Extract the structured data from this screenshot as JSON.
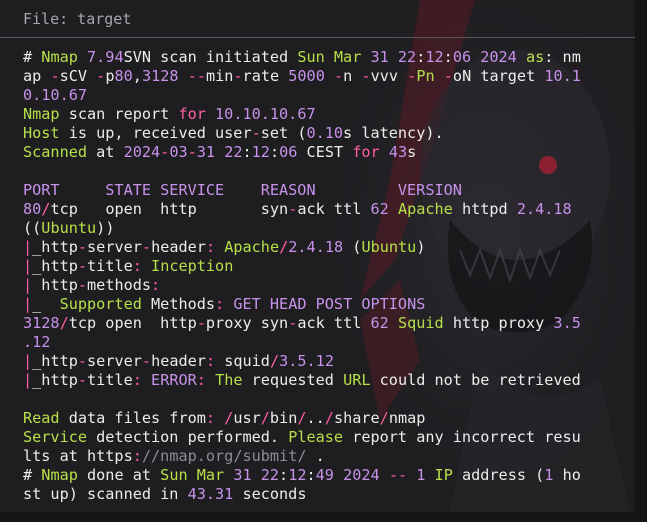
{
  "header": {
    "title": "File: target"
  },
  "colors": {
    "background": "#1e1d20",
    "green": "#b6e04a",
    "purple": "#c792ea",
    "pink": "#ff5fa0",
    "text": "#e8e6ea",
    "header_text": "#a7a5aa"
  },
  "lines": [
    [
      [
        "w",
        "# "
      ],
      [
        "g",
        "Nmap "
      ],
      [
        "p",
        "7.94"
      ],
      [
        "w",
        "SVN scan initiated "
      ],
      [
        "g",
        "Sun Mar "
      ],
      [
        "p",
        "31 22"
      ],
      [
        "w",
        ":"
      ],
      [
        "p",
        "12"
      ],
      [
        "w",
        ":"
      ],
      [
        "p",
        "06 2024 "
      ],
      [
        "g",
        "as"
      ],
      [
        "w",
        ": nm"
      ]
    ],
    [
      [
        "w",
        "ap "
      ],
      [
        "k",
        "-"
      ],
      [
        "w",
        "sCV "
      ],
      [
        "k",
        "-"
      ],
      [
        "w",
        "p"
      ],
      [
        "p",
        "80"
      ],
      [
        "w",
        ","
      ],
      [
        "p",
        "3128 "
      ],
      [
        "k",
        "--"
      ],
      [
        "w",
        "min"
      ],
      [
        "k",
        "-"
      ],
      [
        "w",
        "rate "
      ],
      [
        "p",
        "5000 "
      ],
      [
        "k",
        "-"
      ],
      [
        "w",
        "n "
      ],
      [
        "k",
        "-"
      ],
      [
        "w",
        "vvv "
      ],
      [
        "k",
        "-"
      ],
      [
        "g",
        "Pn "
      ],
      [
        "k",
        "-"
      ],
      [
        "w",
        "oN target "
      ],
      [
        "p",
        "10.1"
      ]
    ],
    [
      [
        "p",
        "0.10.67"
      ]
    ],
    [
      [
        "g",
        "Nmap "
      ],
      [
        "w",
        "scan report "
      ],
      [
        "k",
        "for "
      ],
      [
        "p",
        "10.10.10.67"
      ]
    ],
    [
      [
        "g",
        "Host "
      ],
      [
        "w",
        "is up, received user"
      ],
      [
        "k",
        "-"
      ],
      [
        "w",
        "set ("
      ],
      [
        "p",
        "0.10"
      ],
      [
        "w",
        "s latency)."
      ]
    ],
    [
      [
        "g",
        "Scanned "
      ],
      [
        "w",
        "at "
      ],
      [
        "p",
        "2024"
      ],
      [
        "k",
        "-"
      ],
      [
        "p",
        "03"
      ],
      [
        "k",
        "-"
      ],
      [
        "p",
        "31 22"
      ],
      [
        "w",
        ":"
      ],
      [
        "p",
        "12"
      ],
      [
        "w",
        ":"
      ],
      [
        "p",
        "06 "
      ],
      [
        "w",
        "CEST "
      ],
      [
        "k",
        "for "
      ],
      [
        "p",
        "43"
      ],
      [
        "w",
        "s"
      ]
    ],
    [
      [
        "w",
        ""
      ]
    ],
    [
      [
        "p",
        "PORT     STATE SERVICE    REASON         VERSION"
      ]
    ],
    [
      [
        "p",
        "80"
      ],
      [
        "k",
        "/"
      ],
      [
        "w",
        "tcp   open  http       syn"
      ],
      [
        "k",
        "-"
      ],
      [
        "w",
        "ack ttl "
      ],
      [
        "p",
        "62 "
      ],
      [
        "g",
        "Apache "
      ],
      [
        "w",
        "httpd "
      ],
      [
        "p",
        "2.4.18"
      ]
    ],
    [
      [
        "w",
        "(("
      ],
      [
        "g",
        "Ubuntu"
      ],
      [
        "w",
        "))"
      ]
    ],
    [
      [
        "k",
        "|"
      ],
      [
        "w",
        "_http"
      ],
      [
        "k",
        "-"
      ],
      [
        "w",
        "server"
      ],
      [
        "k",
        "-"
      ],
      [
        "w",
        "header"
      ],
      [
        "k",
        ": "
      ],
      [
        "g",
        "Apache"
      ],
      [
        "k",
        "/"
      ],
      [
        "p",
        "2.4.18 "
      ],
      [
        "w",
        "("
      ],
      [
        "g",
        "Ubuntu"
      ],
      [
        "w",
        ")"
      ]
    ],
    [
      [
        "k",
        "|"
      ],
      [
        "w",
        "_http"
      ],
      [
        "k",
        "-"
      ],
      [
        "w",
        "title"
      ],
      [
        "k",
        ": "
      ],
      [
        "g",
        "Inception"
      ]
    ],
    [
      [
        "k",
        "| "
      ],
      [
        "w",
        "http"
      ],
      [
        "k",
        "-"
      ],
      [
        "w",
        "methods"
      ],
      [
        "k",
        ":"
      ]
    ],
    [
      [
        "k",
        "|"
      ],
      [
        "w",
        "_  "
      ],
      [
        "g",
        "Supported "
      ],
      [
        "w",
        "Methods"
      ],
      [
        "k",
        ": "
      ],
      [
        "p",
        "GET HEAD POST OPTIONS"
      ]
    ],
    [
      [
        "p",
        "3128"
      ],
      [
        "k",
        "/"
      ],
      [
        "w",
        "tcp open  http"
      ],
      [
        "k",
        "-"
      ],
      [
        "w",
        "proxy syn"
      ],
      [
        "k",
        "-"
      ],
      [
        "w",
        "ack ttl "
      ],
      [
        "p",
        "62 "
      ],
      [
        "g",
        "Squid "
      ],
      [
        "w",
        "http proxy "
      ],
      [
        "p",
        "3.5"
      ]
    ],
    [
      [
        "p",
        ".12"
      ]
    ],
    [
      [
        "k",
        "|"
      ],
      [
        "w",
        "_http"
      ],
      [
        "k",
        "-"
      ],
      [
        "w",
        "server"
      ],
      [
        "k",
        "-"
      ],
      [
        "w",
        "header"
      ],
      [
        "k",
        ": "
      ],
      [
        "w",
        "squid"
      ],
      [
        "k",
        "/"
      ],
      [
        "p",
        "3.5.12"
      ]
    ],
    [
      [
        "k",
        "|"
      ],
      [
        "w",
        "_http"
      ],
      [
        "k",
        "-"
      ],
      [
        "w",
        "title"
      ],
      [
        "k",
        ": "
      ],
      [
        "p",
        "ERROR"
      ],
      [
        "k",
        ": "
      ],
      [
        "g",
        "The "
      ],
      [
        "w",
        "requested "
      ],
      [
        "g",
        "URL "
      ],
      [
        "w",
        "could not be retrieved"
      ]
    ],
    [
      [
        "w",
        ""
      ]
    ],
    [
      [
        "g",
        "Read "
      ],
      [
        "w",
        "data files from"
      ],
      [
        "k",
        ": /"
      ],
      [
        "w",
        "usr"
      ],
      [
        "k",
        "/"
      ],
      [
        "w",
        "bin"
      ],
      [
        "k",
        "/"
      ],
      [
        "w",
        ".."
      ],
      [
        "k",
        "/"
      ],
      [
        "w",
        "share"
      ],
      [
        "k",
        "/"
      ],
      [
        "w",
        "nmap"
      ]
    ],
    [
      [
        "g",
        "Service "
      ],
      [
        "w",
        "detection performed. "
      ],
      [
        "g",
        "Please "
      ],
      [
        "w",
        "report any incorrect resu"
      ]
    ],
    [
      [
        "w",
        "lts at https"
      ],
      [
        "k",
        ":"
      ],
      [
        "c",
        "//nmap.org/submit/ "
      ],
      [
        "w",
        "."
      ]
    ],
    [
      [
        "w",
        "# "
      ],
      [
        "g",
        "Nmap "
      ],
      [
        "w",
        "done at "
      ],
      [
        "g",
        "Sun Mar "
      ],
      [
        "p",
        "31 22"
      ],
      [
        "w",
        ":"
      ],
      [
        "p",
        "12"
      ],
      [
        "w",
        ":"
      ],
      [
        "p",
        "49 2024 "
      ],
      [
        "k",
        "-- "
      ],
      [
        "p",
        "1 "
      ],
      [
        "g",
        "IP "
      ],
      [
        "w",
        "address ("
      ],
      [
        "p",
        "1 "
      ],
      [
        "w",
        "ho"
      ]
    ],
    [
      [
        "w",
        "st up) scanned in "
      ],
      [
        "p",
        "43.31 "
      ],
      [
        "w",
        "seconds"
      ]
    ]
  ]
}
